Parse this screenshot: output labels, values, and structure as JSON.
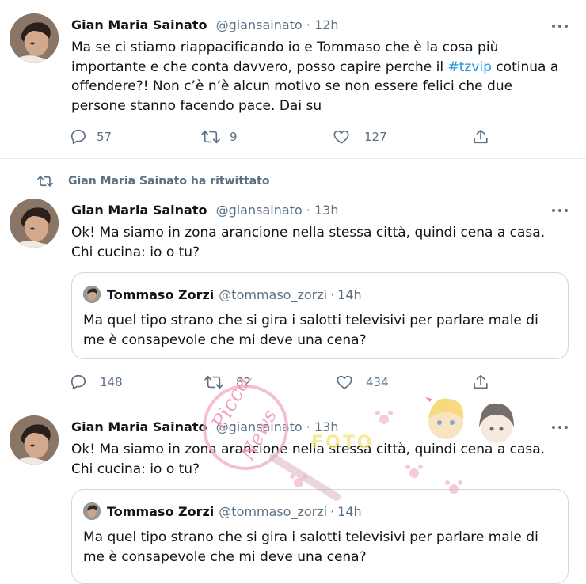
{
  "tweets": [
    {
      "name": "Gian Maria Sainato",
      "handle": "@giansainato",
      "dot": "·",
      "time": "12h",
      "text_before": "Ma se ci stiamo riappacificando io e Tommaso che è la cosa più importante e che conta davvero, posso capire perche il ",
      "hashtag": "#tzvip",
      "text_after": " cotinua a offendere?! Non c’è n’è alcun motivo se non essere felici che due persone stanno facendo pace. Dai su",
      "replies": "57",
      "retweets": "9",
      "likes": "127"
    },
    {
      "retweet_label": "Gian Maria Sainato ha ritwittato",
      "name": "Gian Maria Sainato",
      "handle": "@giansainato",
      "dot": "·",
      "time": "13h",
      "text": "Ok! Ma siamo in zona arancione nella stessa città, quindi cena a casa. Chi cucina: io o tu?",
      "quote": {
        "name": "Tommaso Zorzi",
        "handle": "@tommaso_zorzi",
        "dot": "·",
        "time": "14h",
        "text": "Ma quel tipo strano che si gira i salotti televisivi per parlare male di me è consapevole che mi deve una cena?"
      },
      "replies": "148",
      "retweets": "82",
      "likes": "434"
    },
    {
      "name": "Gian Maria Sainato",
      "handle": "@giansainato",
      "dot": "·",
      "time": "13h",
      "text": "Ok! Ma siamo in zona arancione nella stessa città, quindi cena a casa. Chi cucina: io o tu?",
      "quote": {
        "name": "Tommaso Zorzi",
        "handle": "@tommaso_zorzi",
        "dot": "·",
        "time": "14h",
        "text": "Ma quel tipo strano che si gira i salotti televisivi per parlare male di me è consapevole che mi deve una cena?"
      },
      "watermark_text": "Piccolo News",
      "watermark_sub": "FOTO"
    }
  ],
  "colors": {
    "text": "#0f1419",
    "muted": "#5b7083",
    "link": "#1b95e0",
    "border": "#cfd9de",
    "divider": "#e6ecf0"
  }
}
